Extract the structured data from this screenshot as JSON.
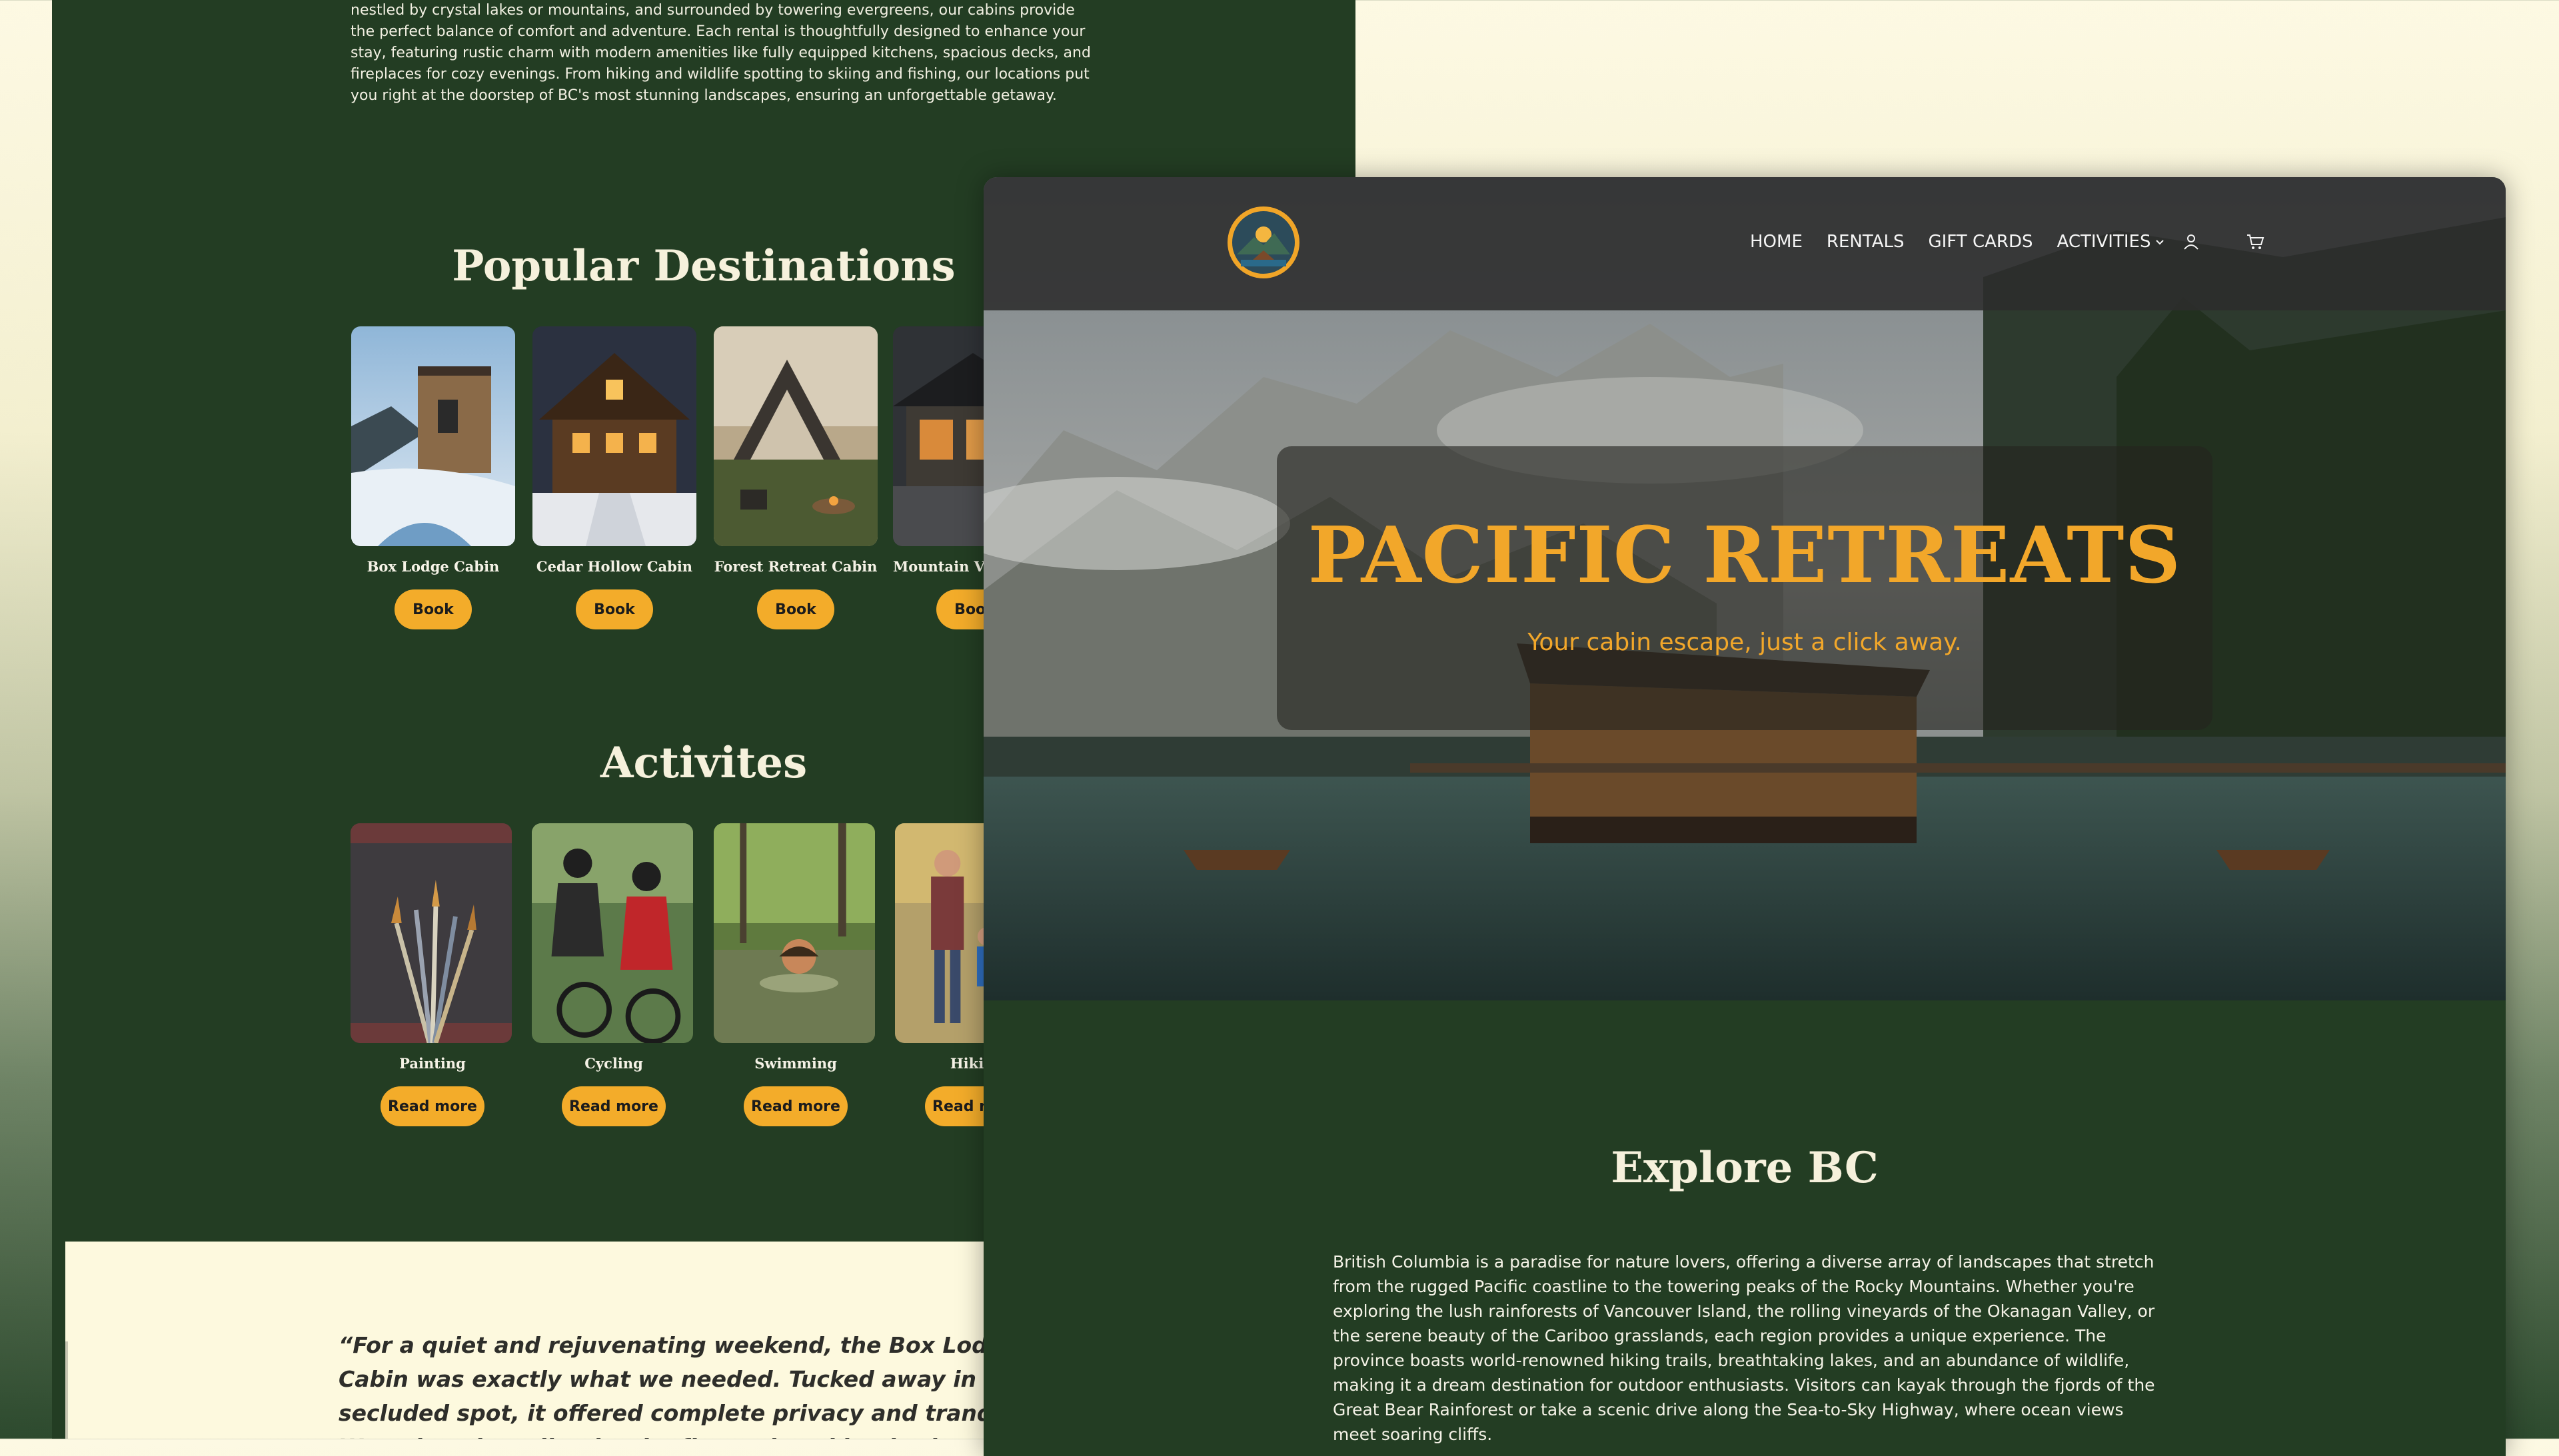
{
  "back_page": {
    "intro": "nestled by crystal lakes or mountains, and surrounded by towering evergreens, our cabins provide the perfect balance of comfort and adventure. Each rental is thoughtfully designed to enhance your stay, featuring rustic charm with modern amenities like fully equipped kitchens, spacious decks, and fireplaces for cozy evenings. From hiking and wildlife spotting to skiing and fishing, our locations put you right at the doorstep of BC's most stunning landscapes, ensuring an unforgettable getaway.",
    "destinations_title": "Popular Destinations",
    "destinations": [
      {
        "name": "Box Lodge Cabin",
        "button": "Book"
      },
      {
        "name": "Cedar Hollow Cabin",
        "button": "Book"
      },
      {
        "name": "Forest Retreat Cabin",
        "button": "Book"
      },
      {
        "name": "Mountain View Cabin",
        "button": "Book"
      }
    ],
    "activities_title": "Activites",
    "activities": [
      {
        "name": "Painting",
        "button": "Read more"
      },
      {
        "name": "Cycling",
        "button": "Read more"
      },
      {
        "name": "Swimming",
        "button": "Read more"
      },
      {
        "name": "Hiking",
        "button": "Read more"
      }
    ],
    "testimonial": "“For a quiet and rejuvenating weekend, the Box Lodge Cabin was exactly what we needed. Tucked away in a secluded spot, it offered complete privacy and tranquility. We enjoyed reading by the fire and soaking in the views.”"
  },
  "front_page": {
    "nav": {
      "items": [
        "HOME",
        "RENTALS",
        "GIFT CARDS",
        "ACTIVITIES"
      ],
      "icons": [
        "user-icon",
        "cart-icon"
      ]
    },
    "hero": {
      "title": "PACIFIC RETREATS",
      "subtitle": "Your cabin escape, just a click away."
    },
    "explore": {
      "title": "Explore BC",
      "text": "British Columbia is a paradise for nature lovers, offering a diverse array of landscapes that stretch from the rugged Pacific coastline to the towering peaks of the Rocky Mountains. Whether you're exploring the lush rainforests of Vancouver Island, the rolling vineyards of the Okanagan Valley, or the serene beauty of the Cariboo grasslands, each region provides a unique experience. The province boasts world-renowned hiking trails, breathtaking lakes, and an abundance of wildlife, making it a dream destination for outdoor enthusiasts. Visitors can kayak through the fjords of the Great Bear Rainforest or take a scenic drive along the Sea-to-Sky Highway, where ocean views meet soaring cliffs."
    }
  },
  "colors": {
    "forest_green": "#233d23",
    "accent_orange": "#f3ac2a",
    "cream": "#fdf9de"
  }
}
